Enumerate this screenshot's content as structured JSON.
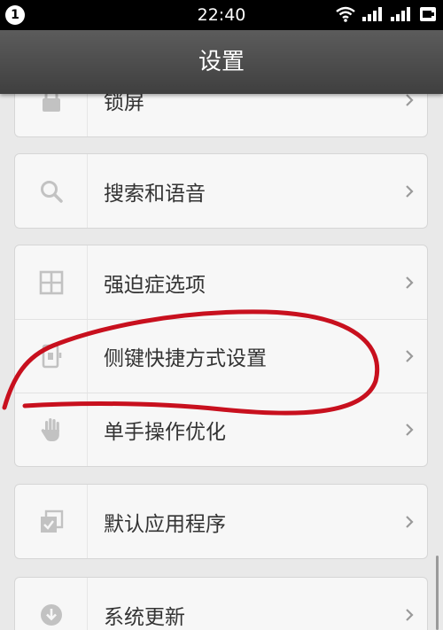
{
  "status_bar": {
    "notification_count": "1",
    "time": "22:40",
    "icons": [
      "wifi-icon",
      "signal-icon",
      "signal-icon",
      "battery-icon"
    ]
  },
  "header": {
    "title": "设置"
  },
  "groups": [
    {
      "items": [
        {
          "label": "锁屏",
          "icon": "lock-icon"
        }
      ]
    },
    {
      "items": [
        {
          "label": "搜索和语音",
          "icon": "search-icon"
        }
      ]
    },
    {
      "items": [
        {
          "label": "强迫症选项",
          "icon": "grid-icon"
        },
        {
          "label": "侧键快捷方式设置",
          "icon": "side-key-icon"
        },
        {
          "label": "单手操作优化",
          "icon": "hand-icon"
        }
      ]
    },
    {
      "items": [
        {
          "label": "默认应用程序",
          "icon": "default-apps-icon"
        }
      ]
    },
    {
      "items": [
        {
          "label": "系统更新",
          "icon": "download-icon"
        }
      ]
    }
  ],
  "colors": {
    "annotation": "#c8101e",
    "title_bar": "#4a4a4a",
    "background": "#e9e9e9",
    "card": "#f7f7f7",
    "icon": "#c2c2c2"
  }
}
